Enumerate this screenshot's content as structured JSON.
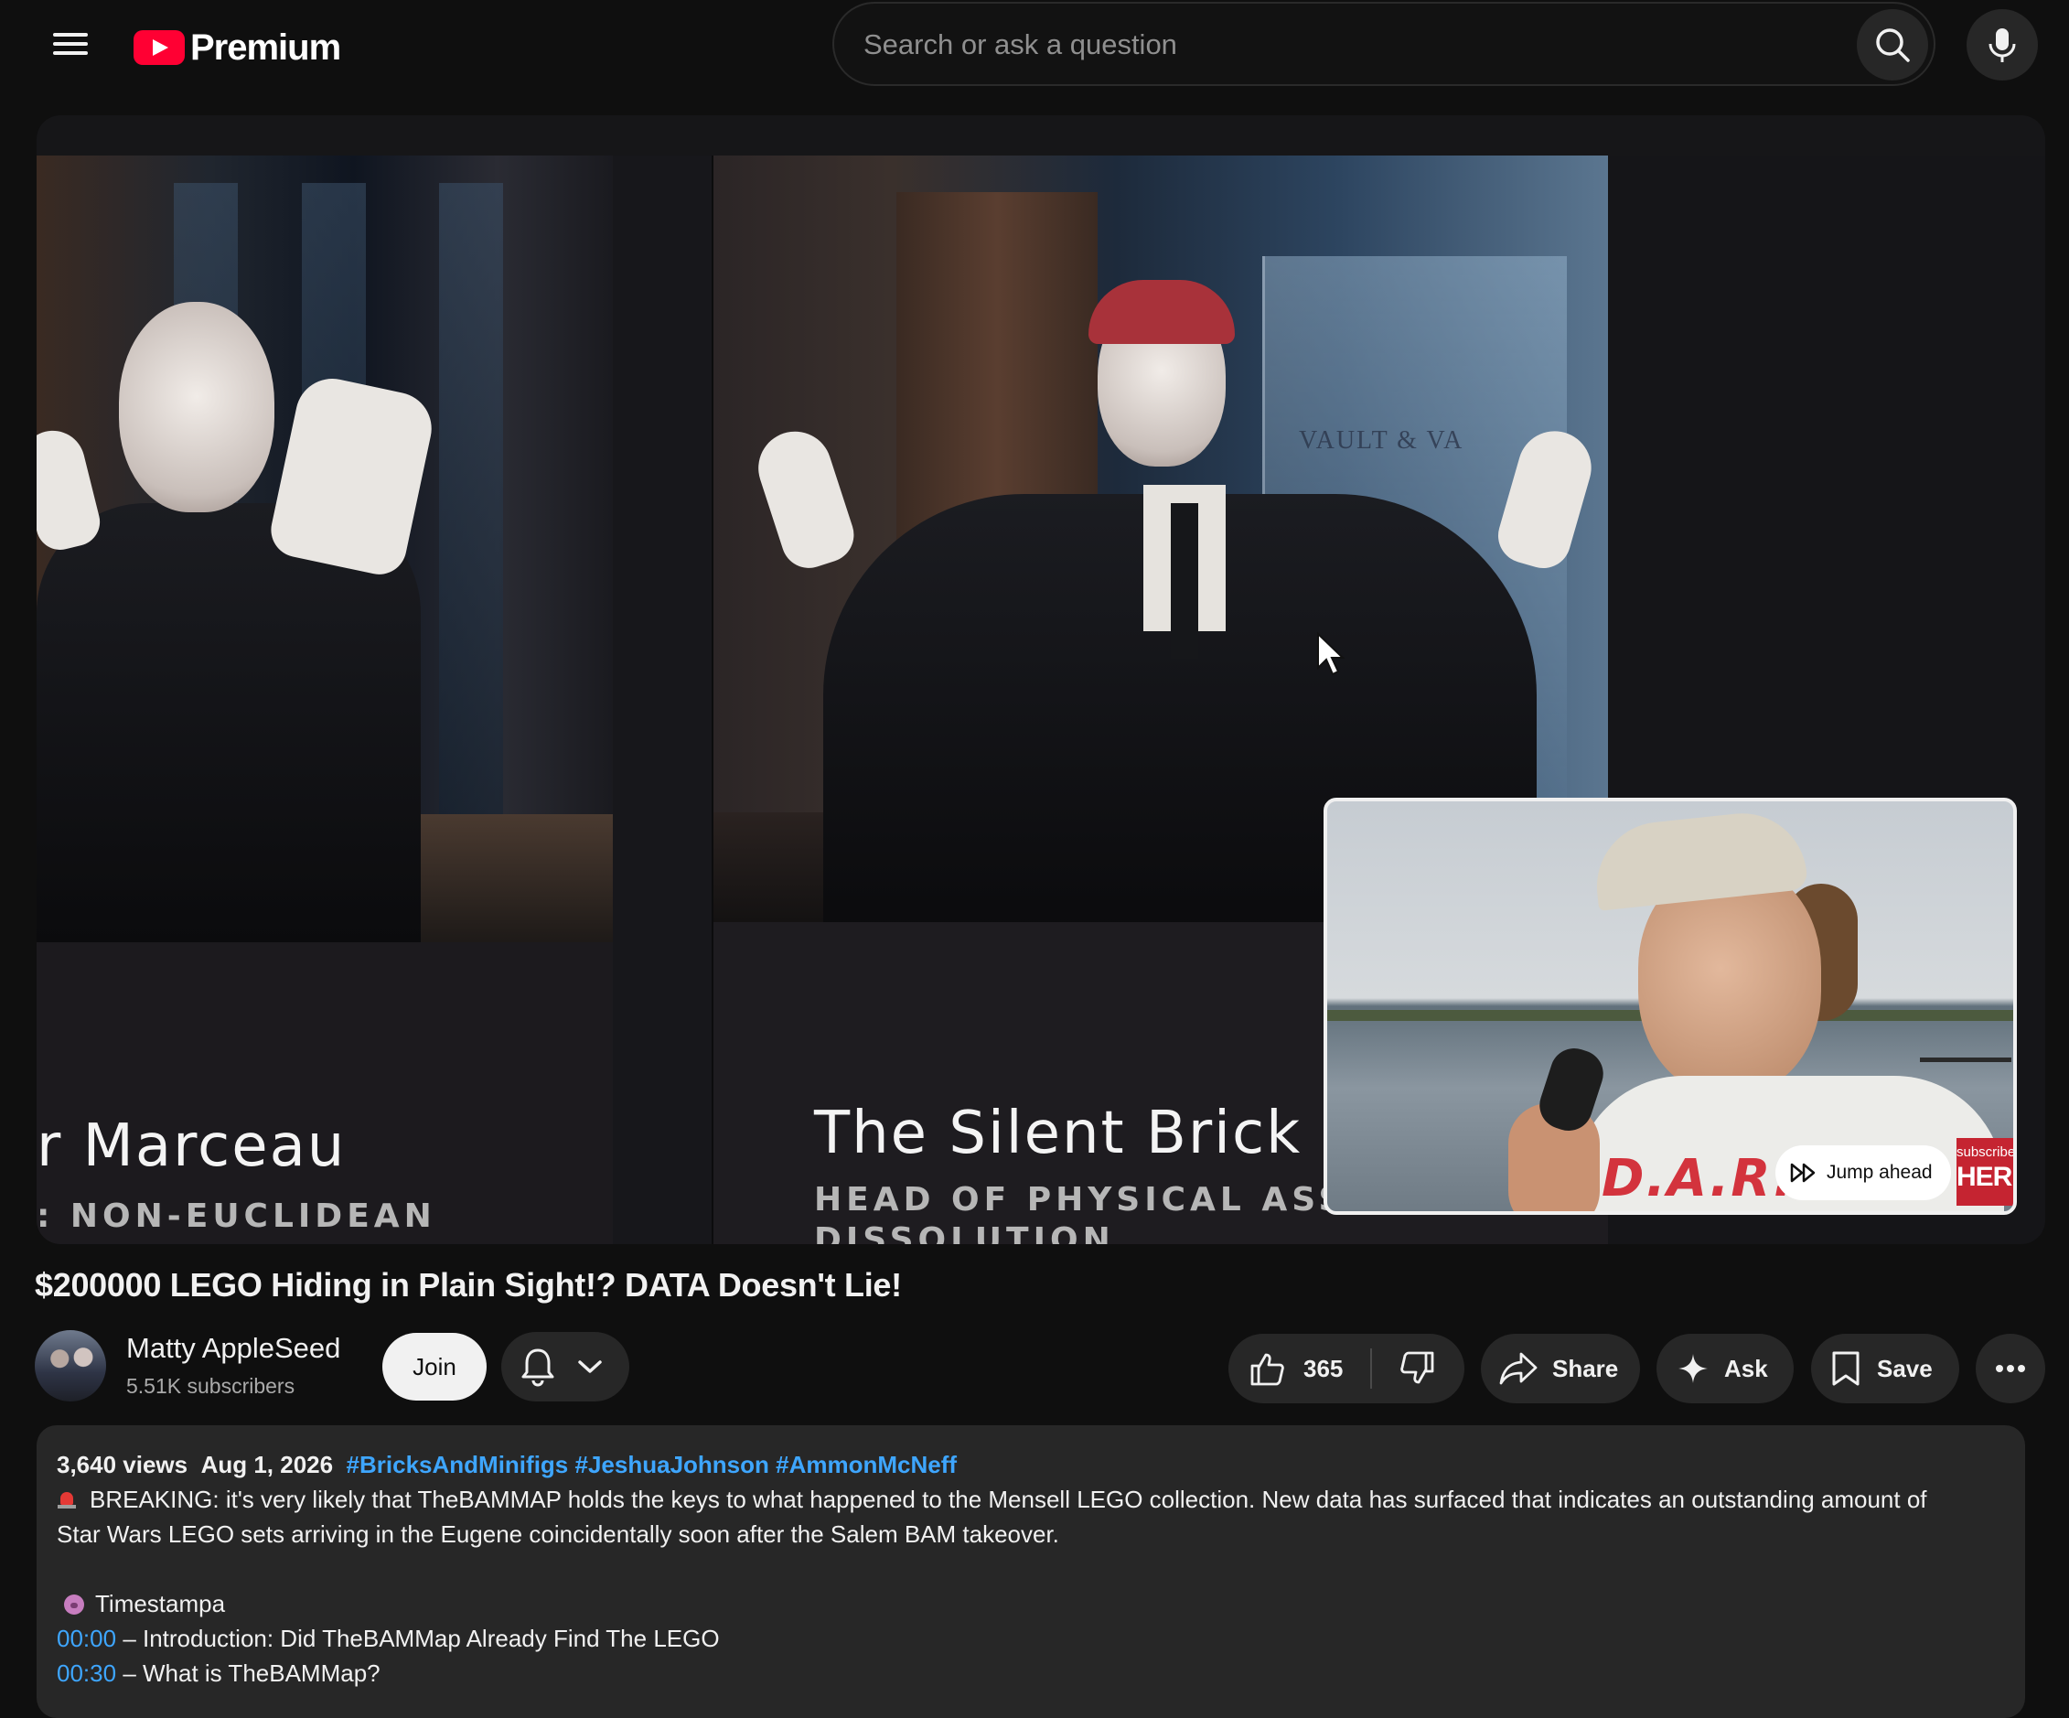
{
  "header": {
    "logo_text": "Premium",
    "search_placeholder": "Search or ask a question",
    "icons": {
      "menu": "hamburger-menu-icon",
      "search": "search-icon",
      "mic": "microphone-icon"
    }
  },
  "player": {
    "left_caption": {
      "name": "r Marceau",
      "role": ": NON-EUCLIDEAN"
    },
    "right_caption": {
      "name": "The Silent Brick",
      "role_line1": "HEAD OF PHYSICAL ASSET",
      "role_line2": "DISSOLUTION"
    },
    "background_sign": "VAULT & VA",
    "mini_player": {
      "shirt_text": "D.A.R.E",
      "jump_label": "Jump ahead",
      "badge_top": "subscribe",
      "badge_bottom": "HERE"
    }
  },
  "video": {
    "title": "$200000 LEGO Hiding in Plain Sight!? DATA Doesn't Lie!",
    "channel": {
      "name": "Matty AppleSeed",
      "subscribers": "5.51K subscribers"
    },
    "join_label": "Join",
    "like_count": "365",
    "share_label": "Share",
    "ask_label": "Ask",
    "save_label": "Save"
  },
  "description": {
    "views": "3,640 views",
    "date": "Aug 1, 2026",
    "hashtags": [
      "#BricksAndMinifigs",
      "#JeshuaJohnson",
      "#AmmonMcNeff"
    ],
    "line1": "BREAKING: it's very likely that TheBAMMAP holds the keys to what happened to the Mensell LEGO collection. New data has surfaced that indicates an outstanding amount of",
    "line2": "Star Wars LEGO sets arriving in the Eugene coincidentally soon after the Salem BAM takeover.",
    "timestamps_header": "Timestampa",
    "chapters": [
      {
        "time": "00:00",
        "text": "– Introduction: Did TheBAMMap Already Find The LEGO"
      },
      {
        "time": "00:30",
        "text": "– What is TheBAMMap?"
      }
    ]
  },
  "colors": {
    "accent_red": "#ff0033",
    "link_blue": "#3ea6ff",
    "background": "#0f0f0f",
    "chip": "#272727"
  }
}
